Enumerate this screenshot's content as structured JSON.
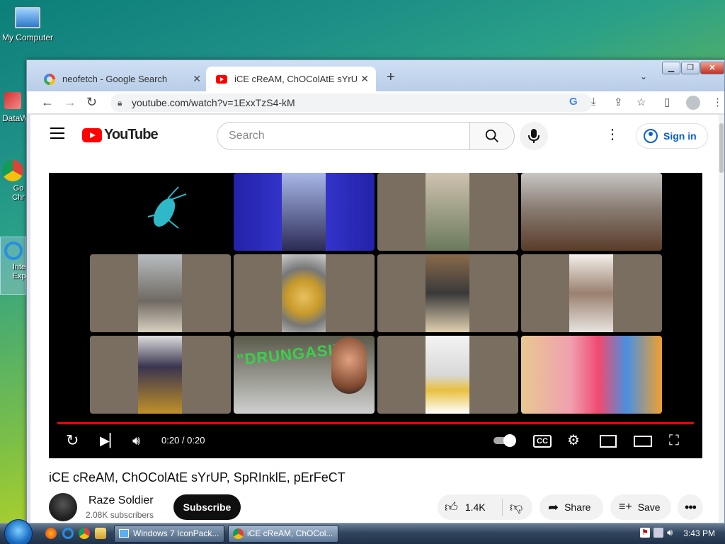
{
  "desktop": {
    "icons": [
      {
        "name": "My Computer"
      },
      {
        "name": "DataW"
      },
      {
        "name": "Go Chr"
      },
      {
        "name": "Inte Exp"
      }
    ]
  },
  "browser": {
    "tabs": [
      {
        "label": "neofetch - Google Search",
        "active": false
      },
      {
        "label": "iCE cReAM, ChOColAtE sYrUP, Sp",
        "active": true
      }
    ],
    "new_tab": "+",
    "url": "youtube.com/watch?v=1ExxTzS4-kM"
  },
  "youtube": {
    "logo_text": "YouTube",
    "search_placeholder": "Search",
    "sign_in": "Sign in",
    "player": {
      "time": "0:20 / 0:20",
      "progress": 1.0,
      "cc": "CC"
    },
    "video_title": "iCE cReAM, ChOColAtE sYrUP, SpRInklE, pErFeCT",
    "channel": {
      "name": "Raze Soldier",
      "subscribers": "2.08K subscribers"
    },
    "subscribe": "Subscribe",
    "likes": "1.4K",
    "share": "Share",
    "save": "Save",
    "tile_caption": "\"DRUNGASI\""
  },
  "taskbar": {
    "tasks": [
      {
        "label": "Windows 7 IconPack..."
      },
      {
        "label": "iCE cReAM, ChOCol..."
      }
    ],
    "clock": "3:43 PM"
  },
  "colors": {
    "youtube_red": "#ff0000",
    "link_blue": "#065fd4"
  }
}
